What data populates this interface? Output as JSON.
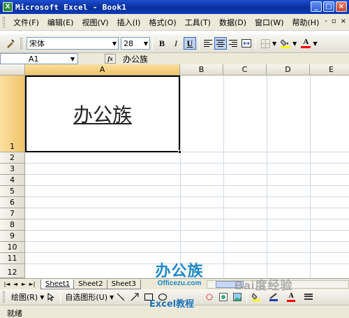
{
  "titlebar": {
    "app_icon": "X",
    "title": "Microsoft Excel - Book1",
    "buttons": [
      "_",
      "□",
      "×"
    ]
  },
  "menubar": {
    "items": [
      {
        "label": "文件(F)"
      },
      {
        "label": "编辑(E)"
      },
      {
        "label": "视图(V)"
      },
      {
        "label": "插入(I)"
      },
      {
        "label": "格式(O)"
      },
      {
        "label": "工具(T)"
      },
      {
        "label": "数据(D)"
      },
      {
        "label": "窗口(W)"
      },
      {
        "label": "帮助(H)"
      }
    ],
    "mdi_buttons": [
      "-",
      "▫",
      "×"
    ]
  },
  "toolbar": {
    "font_name": "宋体",
    "font_size": "28",
    "bold_label": "B",
    "italic_label": "I",
    "underline_label": "U",
    "fill_color": "#ffff00",
    "font_color": "#ff0000",
    "icons": [
      "toolbar-options-icon",
      "align-left-icon",
      "align-center-icon",
      "align-right-icon",
      "merge-center-icon",
      "borders-icon",
      "fill-color-icon",
      "font-color-icon"
    ]
  },
  "formulabar": {
    "name_box": "A1",
    "fx_label": "fx",
    "formula_value": "办公族"
  },
  "grid": {
    "columns": [
      "A",
      "B",
      "C",
      "D",
      "E"
    ],
    "rows": [
      "1",
      "2",
      "3",
      "4",
      "5",
      "6",
      "7",
      "8",
      "9",
      "10",
      "11",
      "12"
    ],
    "active_cell": "A1",
    "cell_a1_value": "办公族"
  },
  "sheet_tabs": {
    "nav": [
      "|◄",
      "◄",
      "►",
      "►|"
    ],
    "tabs": [
      {
        "label": "Sheet1",
        "active": true
      },
      {
        "label": "Sheet2",
        "active": false
      },
      {
        "label": "Sheet3",
        "active": false
      }
    ]
  },
  "drawbar": {
    "draw_label": "绘图(R)",
    "autoshapes_label": "自选图形(U)"
  },
  "statusbar": {
    "text": "就绪"
  },
  "watermarks": {
    "logo_main": "办公族",
    "logo_sub": "Officezu.com",
    "excel_tutorial": "Excel教程",
    "baidu": "Bai度经验"
  }
}
